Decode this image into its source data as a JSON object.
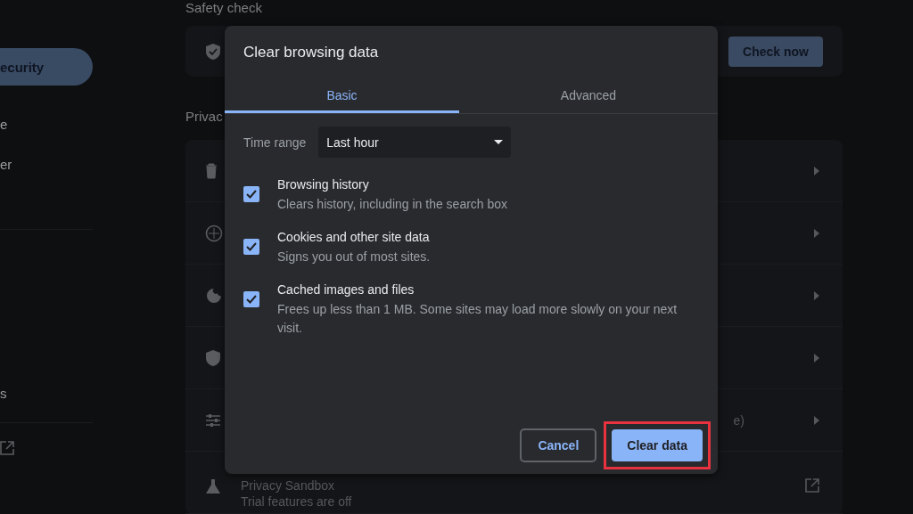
{
  "sidebar": {
    "items": [
      {
        "label": "ecurity",
        "selected": true
      },
      {
        "label": "e",
        "selected": false
      },
      {
        "label": "er",
        "selected": false
      },
      {
        "label": "s",
        "selected": false
      }
    ]
  },
  "safety_check": {
    "heading": "Safety check",
    "button": "Check now"
  },
  "privacy": {
    "heading": "Privac",
    "rows": [
      {
        "kind": "arrow"
      },
      {
        "kind": "arrow"
      },
      {
        "kind": "arrow"
      },
      {
        "kind": "arrow"
      },
      {
        "kind": "arrow",
        "trailing_text": "e)"
      },
      {
        "kind": "external",
        "title": "Privacy Sandbox",
        "subtitle": "Trial features are off"
      }
    ]
  },
  "dialog": {
    "title": "Clear browsing data",
    "tabs": [
      {
        "label": "Basic",
        "selected": true
      },
      {
        "label": "Advanced",
        "selected": false
      }
    ],
    "time_range": {
      "label": "Time range",
      "value": "Last hour"
    },
    "options": [
      {
        "title": "Browsing history",
        "description": "Clears history, including in the search box",
        "checked": true
      },
      {
        "title": "Cookies and other site data",
        "description": "Signs you out of most sites.",
        "checked": true
      },
      {
        "title": "Cached images and files",
        "description": "Frees up less than 1 MB. Some sites may load more slowly on your next visit.",
        "checked": true
      }
    ],
    "cancel_button": "Cancel",
    "confirm_button": {
      "label": "Clear data",
      "highlighted": true
    }
  }
}
